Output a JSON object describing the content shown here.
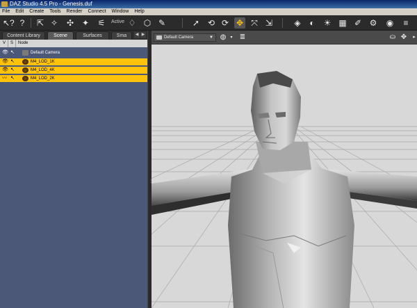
{
  "window": {
    "title": "DAZ Studio 4.5 Pro - Genesis.duf"
  },
  "menu": [
    "File",
    "Edit",
    "Create",
    "Tools",
    "Render",
    "Connect",
    "Window",
    "Help"
  ],
  "toolbar": {
    "active_label": "Active"
  },
  "tabs": [
    "Content Library",
    "Scene",
    "Surfaces",
    "Sma"
  ],
  "scene": {
    "columns": {
      "visible": "V",
      "selectable": "S",
      "node": "Node"
    },
    "nodes": [
      {
        "label": "Default Camera",
        "highlighted": false,
        "type": "camera"
      },
      {
        "label": "M4_LOD_1K",
        "highlighted": true,
        "type": "figure"
      },
      {
        "label": "M4_LOD_4K",
        "highlighted": true,
        "type": "figure"
      },
      {
        "label": "M4_LOD_2K",
        "highlighted": true,
        "type": "figure"
      }
    ]
  },
  "viewport": {
    "camera": "Default Camera"
  },
  "colors": {
    "highlight": "#ffc30b",
    "panel": "#4c5878",
    "viewport_bg": "#d8d8d8"
  }
}
